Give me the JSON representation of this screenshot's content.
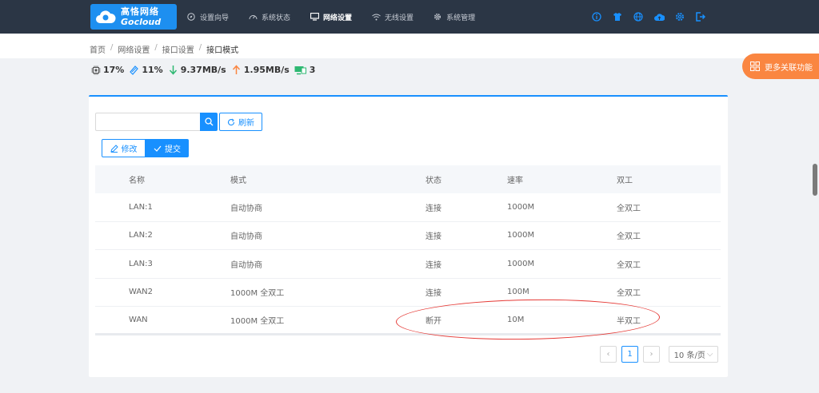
{
  "brand": {
    "cn": "高恪网络",
    "en": "Gocloud"
  },
  "nav": [
    {
      "label": "设置向导",
      "icon": "compass-icon",
      "active": false
    },
    {
      "label": "系统状态",
      "icon": "gauge-icon",
      "active": false
    },
    {
      "label": "网络设置",
      "icon": "monitor-icon",
      "active": true
    },
    {
      "label": "无线设置",
      "icon": "wifi-icon",
      "active": false
    },
    {
      "label": "系统管理",
      "icon": "gear-icon",
      "active": false
    }
  ],
  "top_icons": [
    "info-icon",
    "shirt-icon",
    "globe-icon",
    "cloud-upload-icon",
    "settings-icon",
    "logout-icon"
  ],
  "breadcrumb": [
    "首页",
    "网络设置",
    "接口设置",
    "接口模式"
  ],
  "stats": {
    "cpu": "17%",
    "mem": "11%",
    "down": "9.37MB/s",
    "up": "1.95MB/s",
    "clients": "3"
  },
  "more_button": "更多关联功能",
  "toolbar": {
    "search_placeholder": "",
    "refresh": "刷新",
    "edit": "修改",
    "submit": "提交"
  },
  "table": {
    "headers": [
      "名称",
      "模式",
      "状态",
      "速率",
      "双工"
    ],
    "rows": [
      [
        "LAN:1",
        "自动协商",
        "连接",
        "1000M",
        "全双工"
      ],
      [
        "LAN:2",
        "自动协商",
        "连接",
        "1000M",
        "全双工"
      ],
      [
        "LAN:3",
        "自动协商",
        "连接",
        "1000M",
        "全双工"
      ],
      [
        "WAN2",
        "1000M 全双工",
        "连接",
        "100M",
        "全双工"
      ],
      [
        "WAN",
        "1000M 全双工",
        "断开",
        "10M",
        "半双工"
      ]
    ]
  },
  "pager": {
    "current": "1",
    "page_size": "10 条/页"
  },
  "colors": {
    "accent": "#1890ff",
    "topbar": "#2b3645",
    "orange": "#fa8641",
    "annotation": "#e53935"
  }
}
